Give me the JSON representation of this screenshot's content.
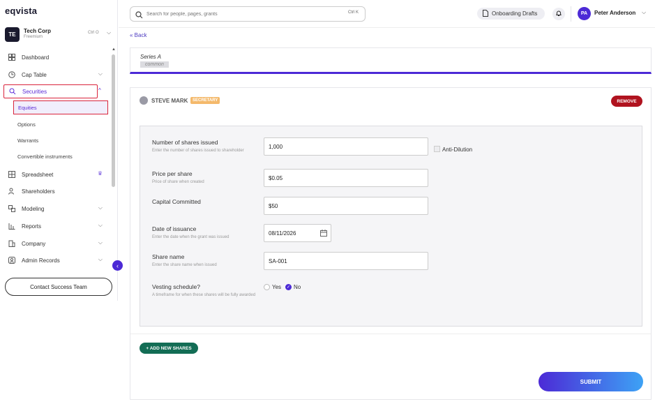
{
  "brand": {
    "logo_text": "eqvista"
  },
  "org": {
    "initials": "TE",
    "name": "Tech Corp",
    "plan": "Freemium",
    "shortcut": "Ctrl O"
  },
  "sidebar": {
    "items": [
      {
        "label": "Dashboard",
        "icon": "dashboard-icon"
      },
      {
        "label": "Cap Table",
        "icon": "cap-table-icon"
      },
      {
        "label": "Securities",
        "icon": "securities-icon"
      },
      {
        "label": "Spreadsheet",
        "icon": "spreadsheet-icon"
      },
      {
        "label": "Shareholders",
        "icon": "shareholders-icon"
      },
      {
        "label": "Modeling",
        "icon": "modeling-icon"
      },
      {
        "label": "Reports",
        "icon": "reports-icon"
      },
      {
        "label": "Company",
        "icon": "company-icon"
      },
      {
        "label": "Admin Records",
        "icon": "admin-records-icon"
      }
    ],
    "securities_sub": [
      "Equities",
      "Options",
      "Warrants",
      "Convertible instruments"
    ],
    "contact_label": "Contact Success Team"
  },
  "topbar": {
    "search_placeholder": "Search for people, pages, grants",
    "search_shortcut": "Ctrl K",
    "drafts_label": "Onboarding Drafts",
    "user_initials": "PA",
    "user_name": "Peter Anderson"
  },
  "main": {
    "back_label": "Back",
    "series_title": "Series A",
    "series_tag": "common",
    "holder_name": "STEVE MARK",
    "holder_role": "SECRETARY",
    "remove_label": "REMOVE",
    "form": {
      "shares_label": "Number of shares issued",
      "shares_help": "Enter the number of shares issued to shareholder",
      "shares_value": "1,000",
      "anti_dilution_label": "Anti-Dilution",
      "price_label": "Price per share",
      "price_help": "Price of share when created",
      "price_value": "$0.05",
      "capital_label": "Capital Committed",
      "capital_value": "$50",
      "date_label": "Date of issuance",
      "date_help": "Enter the date when the grant was issued",
      "date_value": "08/11/2026",
      "sharename_label": "Share name",
      "sharename_help": "Enter the share name when issued",
      "sharename_value": "SA-001",
      "vesting_label": "Vesting schedule?",
      "vesting_help": "A timeframe for when these shares will be fully awarded",
      "yes_label": "Yes",
      "no_label": "No"
    },
    "add_shares_label": "+ ADD NEW SHARES",
    "submit_label": "SUBMIT"
  },
  "colors": {
    "accent": "#4c2ad6",
    "danger": "#b0131f",
    "success": "#136d55",
    "badge": "#f4b96b"
  }
}
